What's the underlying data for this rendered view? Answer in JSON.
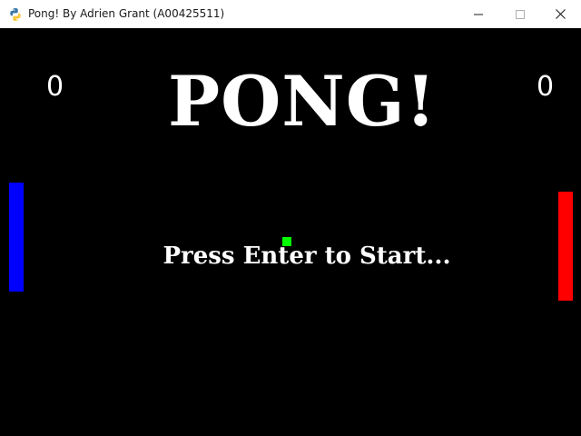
{
  "window": {
    "title": "Pong! By Adrien Grant (A00425511)",
    "icon": "python-icon"
  },
  "controls": {
    "minimize_icon": "minimize-icon",
    "maximize_icon": "maximize-icon",
    "close_icon": "close-icon"
  },
  "game": {
    "title": "PONG!",
    "prompt": "Press Enter to Start...",
    "score_left": "0",
    "score_right": "0",
    "colors": {
      "background": "#000000",
      "left_paddle": "#0000ff",
      "right_paddle": "#ff0000",
      "ball": "#00ff00",
      "text": "#ffffff"
    }
  }
}
